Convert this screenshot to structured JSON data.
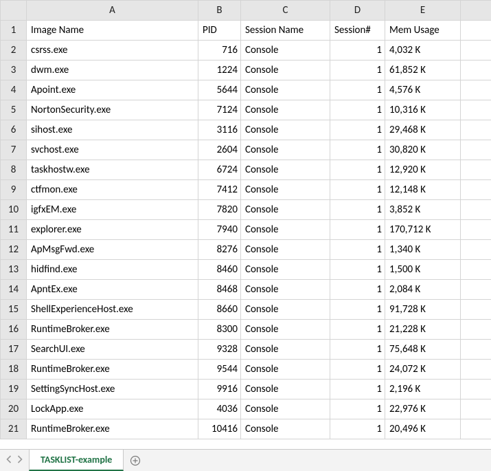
{
  "columns": [
    "A",
    "B",
    "C",
    "D",
    "E",
    ""
  ],
  "headers": {
    "image_name": "Image Name",
    "pid": "PID",
    "session_name": "Session Name",
    "session_num": "Session#",
    "mem_usage": "Mem Usage"
  },
  "rows": [
    {
      "n": "1",
      "a": "Image Name",
      "b": "PID",
      "c": "Session Name",
      "d": "Session#",
      "e": "Mem Usage",
      "is_header": true
    },
    {
      "n": "2",
      "a": "csrss.exe",
      "b": "716",
      "c": "Console",
      "d": "1",
      "e": "4,032 K"
    },
    {
      "n": "3",
      "a": "dwm.exe",
      "b": "1224",
      "c": "Console",
      "d": "1",
      "e": "61,852 K"
    },
    {
      "n": "4",
      "a": "Apoint.exe",
      "b": "5644",
      "c": "Console",
      "d": "1",
      "e": "4,576 K"
    },
    {
      "n": "5",
      "a": "NortonSecurity.exe",
      "b": "7124",
      "c": "Console",
      "d": "1",
      "e": "10,316 K"
    },
    {
      "n": "6",
      "a": "sihost.exe",
      "b": "3116",
      "c": "Console",
      "d": "1",
      "e": "29,468 K"
    },
    {
      "n": "7",
      "a": "svchost.exe",
      "b": "2604",
      "c": "Console",
      "d": "1",
      "e": "30,820 K"
    },
    {
      "n": "8",
      "a": "taskhostw.exe",
      "b": "6724",
      "c": "Console",
      "d": "1",
      "e": "12,920 K"
    },
    {
      "n": "9",
      "a": "ctfmon.exe",
      "b": "7412",
      "c": "Console",
      "d": "1",
      "e": "12,148 K"
    },
    {
      "n": "10",
      "a": "igfxEM.exe",
      "b": "7820",
      "c": "Console",
      "d": "1",
      "e": "3,852 K"
    },
    {
      "n": "11",
      "a": "explorer.exe",
      "b": "7940",
      "c": "Console",
      "d": "1",
      "e": "170,712 K"
    },
    {
      "n": "12",
      "a": "ApMsgFwd.exe",
      "b": "8276",
      "c": "Console",
      "d": "1",
      "e": "1,340 K"
    },
    {
      "n": "13",
      "a": "hidfind.exe",
      "b": "8460",
      "c": "Console",
      "d": "1",
      "e": "1,500 K"
    },
    {
      "n": "14",
      "a": "ApntEx.exe",
      "b": "8468",
      "c": "Console",
      "d": "1",
      "e": "2,084 K"
    },
    {
      "n": "15",
      "a": "ShellExperienceHost.exe",
      "b": "8660",
      "c": "Console",
      "d": "1",
      "e": "91,728 K"
    },
    {
      "n": "16",
      "a": "RuntimeBroker.exe",
      "b": "8300",
      "c": "Console",
      "d": "1",
      "e": "21,228 K"
    },
    {
      "n": "17",
      "a": "SearchUI.exe",
      "b": "9328",
      "c": "Console",
      "d": "1",
      "e": "75,648 K"
    },
    {
      "n": "18",
      "a": "RuntimeBroker.exe",
      "b": "9544",
      "c": "Console",
      "d": "1",
      "e": "24,072 K"
    },
    {
      "n": "19",
      "a": "SettingSyncHost.exe",
      "b": "9916",
      "c": "Console",
      "d": "1",
      "e": "2,196 K"
    },
    {
      "n": "20",
      "a": "LockApp.exe",
      "b": "4036",
      "c": "Console",
      "d": "1",
      "e": "22,976 K"
    },
    {
      "n": "21",
      "a": "RuntimeBroker.exe",
      "b": "10416",
      "c": "Console",
      "d": "1",
      "e": "20,496 K"
    }
  ],
  "sheet_tab": "TASKLIST-example",
  "chart_data": {
    "type": "table",
    "title": "TASKLIST-example",
    "columns": [
      "Image Name",
      "PID",
      "Session Name",
      "Session#",
      "Mem Usage"
    ],
    "records": [
      [
        "csrss.exe",
        716,
        "Console",
        1,
        "4,032 K"
      ],
      [
        "dwm.exe",
        1224,
        "Console",
        1,
        "61,852 K"
      ],
      [
        "Apoint.exe",
        5644,
        "Console",
        1,
        "4,576 K"
      ],
      [
        "NortonSecurity.exe",
        7124,
        "Console",
        1,
        "10,316 K"
      ],
      [
        "sihost.exe",
        3116,
        "Console",
        1,
        "29,468 K"
      ],
      [
        "svchost.exe",
        2604,
        "Console",
        1,
        "30,820 K"
      ],
      [
        "taskhostw.exe",
        6724,
        "Console",
        1,
        "12,920 K"
      ],
      [
        "ctfmon.exe",
        7412,
        "Console",
        1,
        "12,148 K"
      ],
      [
        "igfxEM.exe",
        7820,
        "Console",
        1,
        "3,852 K"
      ],
      [
        "explorer.exe",
        7940,
        "Console",
        1,
        "170,712 K"
      ],
      [
        "ApMsgFwd.exe",
        8276,
        "Console",
        1,
        "1,340 K"
      ],
      [
        "hidfind.exe",
        8460,
        "Console",
        1,
        "1,500 K"
      ],
      [
        "ApntEx.exe",
        8468,
        "Console",
        1,
        "2,084 K"
      ],
      [
        "ShellExperienceHost.exe",
        8660,
        "Console",
        1,
        "91,728 K"
      ],
      [
        "RuntimeBroker.exe",
        8300,
        "Console",
        1,
        "21,228 K"
      ],
      [
        "SearchUI.exe",
        9328,
        "Console",
        1,
        "75,648 K"
      ],
      [
        "RuntimeBroker.exe",
        9544,
        "Console",
        1,
        "24,072 K"
      ],
      [
        "SettingSyncHost.exe",
        9916,
        "Console",
        1,
        "2,196 K"
      ],
      [
        "LockApp.exe",
        4036,
        "Console",
        1,
        "22,976 K"
      ],
      [
        "RuntimeBroker.exe",
        10416,
        "Console",
        1,
        "20,496 K"
      ]
    ]
  }
}
